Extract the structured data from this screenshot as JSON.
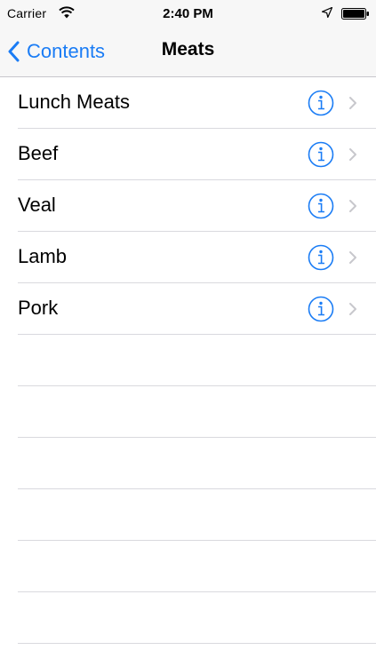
{
  "status_bar": {
    "carrier": "Carrier",
    "time": "2:40 PM",
    "icons": [
      "wifi-icon",
      "location-icon",
      "battery-icon"
    ]
  },
  "nav_bar": {
    "back_label": "Contents",
    "title": "Meats"
  },
  "list": {
    "items": [
      {
        "label": "Lunch Meats"
      },
      {
        "label": "Beef"
      },
      {
        "label": "Veal"
      },
      {
        "label": "Lamb"
      },
      {
        "label": "Pork"
      }
    ]
  },
  "colors": {
    "accent": "#1a7cf5",
    "separator": "#d9d9de",
    "chevron": "#c7c7cc",
    "bar_background": "#f7f7f7"
  }
}
